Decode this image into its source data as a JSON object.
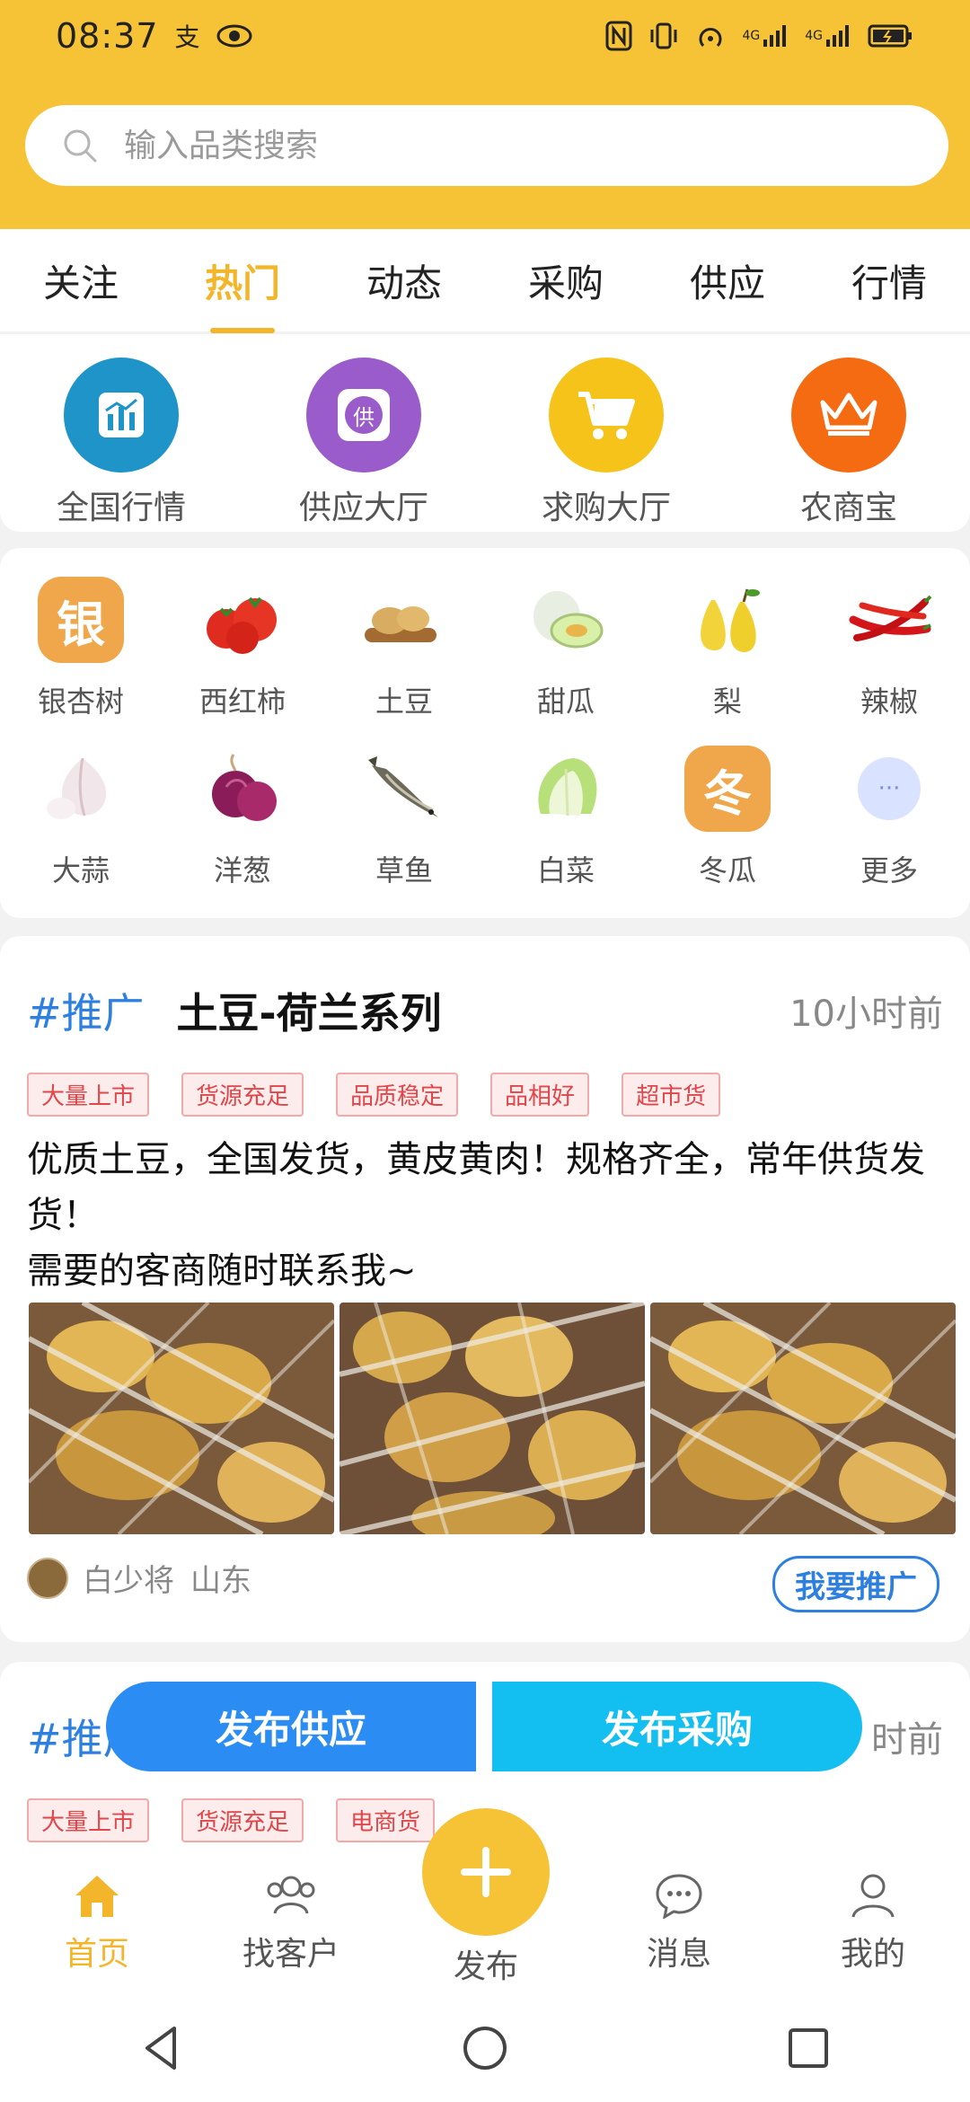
{
  "status_bar": {
    "time": "08:37",
    "net1": "4G",
    "net2": "4G"
  },
  "search": {
    "placeholder": "输入品类搜索"
  },
  "tabs": [
    "关注",
    "热门",
    "动态",
    "采购",
    "供应",
    "行情"
  ],
  "active_tab": "热门",
  "quick_actions": [
    {
      "label": "全国行情",
      "color": "#1e94c9",
      "icon": "chart-icon"
    },
    {
      "label": "供应大厅",
      "color": "#9a5bcb",
      "icon": "supply-icon",
      "glyph": "供"
    },
    {
      "label": "求购大厅",
      "color": "#f6c31a",
      "icon": "cart-icon"
    },
    {
      "label": "农商宝",
      "color": "#f46b12",
      "icon": "crown-icon"
    }
  ],
  "categories": [
    {
      "label": "银杏树",
      "icon": "ginkgo-badge",
      "glyph": "银"
    },
    {
      "label": "西红柿",
      "icon": "tomato-icon"
    },
    {
      "label": "土豆",
      "icon": "potato-icon"
    },
    {
      "label": "甜瓜",
      "icon": "melon-icon"
    },
    {
      "label": "梨",
      "icon": "pear-icon"
    },
    {
      "label": "辣椒",
      "icon": "chili-icon"
    },
    {
      "label": "大蒜",
      "icon": "garlic-icon"
    },
    {
      "label": "洋葱",
      "icon": "onion-icon"
    },
    {
      "label": "草鱼",
      "icon": "fish-icon"
    },
    {
      "label": "白菜",
      "icon": "cabbage-icon"
    },
    {
      "label": "冬瓜",
      "icon": "winter-melon-badge",
      "glyph": "冬"
    },
    {
      "label": "更多",
      "icon": "more-icon",
      "glyph": "···"
    }
  ],
  "post1": {
    "hashtag": "#推广",
    "title": "土豆-荷兰系列",
    "time": "10小时前",
    "tags": [
      "大量上市",
      "货源充足",
      "品质稳定",
      "品相好",
      "超市货"
    ],
    "description": "优质土豆，全国发货，黄皮黄肉！规格齐全，常年供货发货！\n需要的客商随时联系我~",
    "author": "白少将",
    "location": "山东",
    "promote": "我要推广"
  },
  "post2": {
    "hashtag": "#推广",
    "time": "时前",
    "tags": [
      "大量上市",
      "货源充足",
      "电商货"
    ]
  },
  "float_buttons": {
    "supply": "发布供应",
    "buy": "发布采购"
  },
  "bottom_nav": {
    "home": "首页",
    "customers": "找客户",
    "publish": "发布",
    "messages": "消息",
    "mine": "我的"
  },
  "colors": {
    "brand": "#f6c236",
    "accent_blue": "#2d7fe0",
    "tag_red": "#e0464a"
  }
}
